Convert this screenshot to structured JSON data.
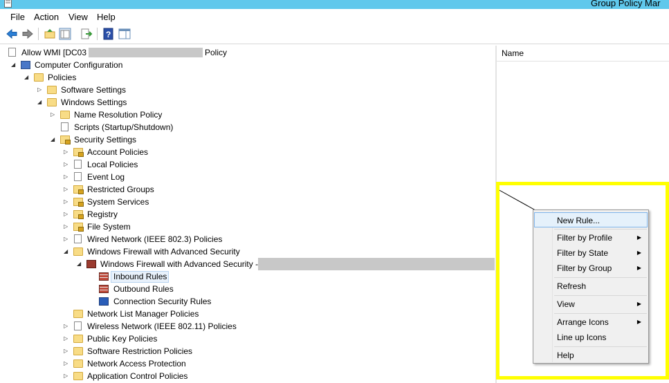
{
  "window": {
    "title": "Group Policy Mar"
  },
  "menubar": {
    "file": "File",
    "action": "Action",
    "view": "View",
    "help": "Help"
  },
  "toolbar": {
    "icons": [
      "back-arrow-icon",
      "forward-arrow-icon",
      "up-folder-icon",
      "show-hide-tree-icon",
      "export-list-icon",
      "help-icon",
      "show-hide-action-pane-icon"
    ]
  },
  "tree": {
    "root_prefix": "Allow WMI  [DC03",
    "root_suffix": "Policy",
    "computer_configuration": "Computer Configuration",
    "policies": "Policies",
    "software_settings": "Software Settings",
    "windows_settings": "Windows Settings",
    "name_resolution_policy": "Name Resolution Policy",
    "scripts": "Scripts (Startup/Shutdown)",
    "security_settings": "Security Settings",
    "account_policies": "Account Policies",
    "local_policies": "Local Policies",
    "event_log": "Event Log",
    "restricted_groups": "Restricted Groups",
    "system_services": "System Services",
    "registry": "Registry",
    "file_system": "File System",
    "wired_network": "Wired Network (IEEE 802.3) Policies",
    "wfas": "Windows Firewall with Advanced Security",
    "wfas_node": "Windows Firewall with Advanced Security -",
    "inbound_rules": "Inbound Rules",
    "outbound_rules": "Outbound Rules",
    "connection_security_rules": "Connection Security Rules",
    "network_list_manager": "Network List Manager Policies",
    "wireless_network": "Wireless Network (IEEE 802.11) Policies",
    "public_key_policies": "Public Key Policies",
    "software_restriction": "Software Restriction Policies",
    "network_access_protection": "Network Access Protection",
    "application_control": "Application Control Policies"
  },
  "details": {
    "column_name": "Name"
  },
  "context_menu": {
    "new_rule": "New Rule...",
    "filter_by_profile": "Filter by Profile",
    "filter_by_state": "Filter by State",
    "filter_by_group": "Filter by Group",
    "refresh": "Refresh",
    "view": "View",
    "arrange_icons": "Arrange Icons",
    "line_up_icons": "Line up Icons",
    "help": "Help"
  },
  "annotation": {
    "highlight_color": "#ffff00",
    "titlebar_color": "#5fc8ec"
  }
}
